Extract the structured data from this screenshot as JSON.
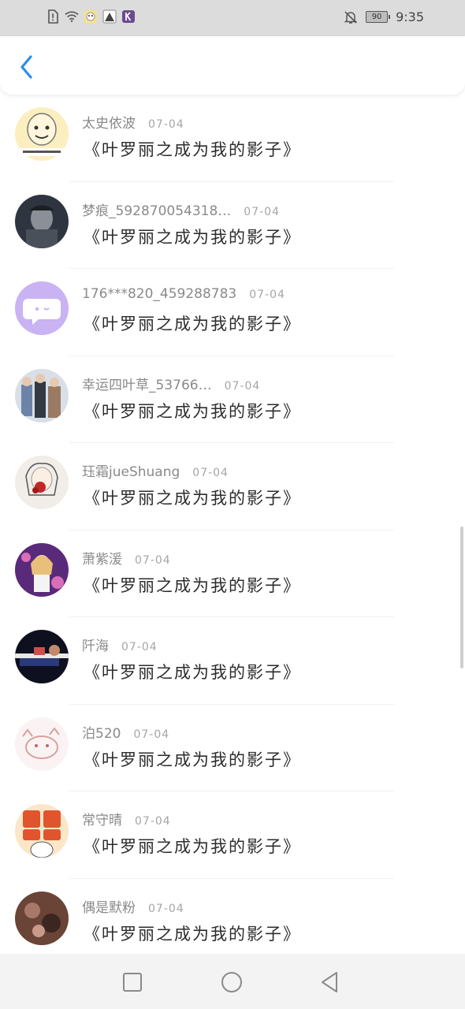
{
  "status_bar": {
    "time": "9:35",
    "battery": "90",
    "icons": [
      "sim-alert-icon",
      "wifi-icon",
      "app-notification-icon",
      "app-notification-icon",
      "k-app-icon",
      "mute-bell-icon"
    ]
  },
  "header": {
    "back_icon": "chevron-left-icon"
  },
  "comments": [
    {
      "user": "太史依波",
      "date": "07-04",
      "text": "《叶罗丽之成为我的影子》"
    },
    {
      "user": "梦痕_592870054318…",
      "date": "07-04",
      "text": "《叶罗丽之成为我的影子》"
    },
    {
      "user": "176***820_459288783",
      "date": "07-04",
      "text": "《叶罗丽之成为我的影子》"
    },
    {
      "user": "幸运四叶草_53766…",
      "date": "07-04",
      "text": "《叶罗丽之成为我的影子》"
    },
    {
      "user": "珏霜jueShuang",
      "date": "07-04",
      "text": "《叶罗丽之成为我的影子》"
    },
    {
      "user": "萧紫湲",
      "date": "07-04",
      "text": "《叶罗丽之成为我的影子》"
    },
    {
      "user": "阡海",
      "date": "07-04",
      "text": "《叶罗丽之成为我的影子》"
    },
    {
      "user": "泊520",
      "date": "07-04",
      "text": "《叶罗丽之成为我的影子》"
    },
    {
      "user": "常守晴",
      "date": "07-04",
      "text": "《叶罗丽之成为我的影子》"
    },
    {
      "user": "偶是默粉",
      "date": "07-04",
      "text": "《叶罗丽之成为我的影子》"
    }
  ],
  "colors": {
    "accent": "#2d8cf0",
    "status_bar_bg": "#dcdcdc",
    "nav_bar_bg": "#f3f3f3"
  },
  "navigation": {
    "buttons": [
      "recent-apps-icon",
      "home-icon",
      "back-triangle-icon"
    ]
  }
}
